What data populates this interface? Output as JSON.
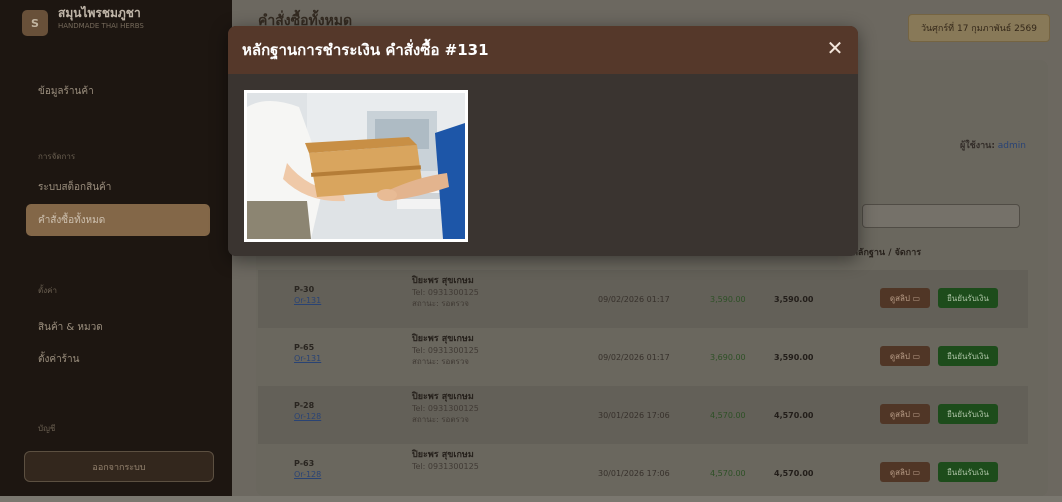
{
  "sidebar": {
    "brand_title": "สมุนไพรชมภูชา",
    "brand_subtitle": "HANDMADE THAI HERBS",
    "logo_text": "S",
    "items": {
      "dashboard": "ข้อมูลร้านค้า",
      "section_heading": "การจัดการ",
      "inventory": "ระบบสต็อกสินค้า",
      "orders": "คำสั่งซื้อทั้งหมด",
      "section_heading2": "ตั้งค่า",
      "products": "สินค้า & หมวด",
      "shop": "ตั้งค่าร้าน",
      "section_heading3": "บัญชี"
    },
    "logout_label": "ออกจากระบบ"
  },
  "header": {
    "page_title": "คำสั่งซื้อทั้งหมด",
    "date_badge": "วันศุกร์ที่ 17 กุมภาพันธ์ 2569"
  },
  "filters": {
    "prefix": "ผู้ใช้งาน:",
    "link": "admin"
  },
  "table": {
    "evidence_header": "หลักฐาน / จัดการ",
    "rows": [
      {
        "pid": "P-30",
        "order": "Or-131",
        "name": "ปิยะพร สุขเกษม",
        "tel": "Tel: 0931300125",
        "status": "สถานะ: รอตรวจ",
        "date": "09/02/2026 01:17",
        "amount": "3,590.00",
        "total": "3,590.00",
        "slip": "ดูสลิป",
        "confirm": "ยืนยันรับเงิน"
      },
      {
        "pid": "P-65",
        "order": "Or-131",
        "name": "ปิยะพร สุขเกษม",
        "tel": "Tel: 0931300125",
        "status": "สถานะ: รอตรวจ",
        "date": "09/02/2026 01:17",
        "amount": "3,690.00",
        "total": "3,590.00",
        "slip": "ดูสลิป",
        "confirm": "ยืนยันรับเงิน"
      },
      {
        "pid": "P-28",
        "order": "Or-128",
        "name": "ปิยะพร สุขเกษม",
        "tel": "Tel: 0931300125",
        "status": "สถานะ: รอตรวจ",
        "date": "30/01/2026 17:06",
        "amount": "4,570.00",
        "total": "4,570.00",
        "slip": "ดูสลิป",
        "confirm": "ยืนยันรับเงิน"
      },
      {
        "pid": "P-63",
        "order": "Or-128",
        "name": "ปิยะพร สุขเกษม",
        "tel": "Tel: 0931300125",
        "status": "",
        "date": "30/01/2026 17:06",
        "amount": "4,570.00",
        "total": "4,570.00",
        "slip": "ดูสลิป",
        "confirm": "ยืนยันรับเงิน"
      }
    ]
  },
  "modal": {
    "title": "หลักฐานการชำระเงิน คำสั่งซื้อ #131",
    "close_glyph": "✕"
  },
  "icons": {
    "close": "close-icon",
    "slip_image": "payment-slip-image",
    "camera": "image-icon"
  },
  "colors": {
    "sidebar_bg": "#1f1813",
    "accent_active": "#9c7a56",
    "modal_header": "#55382a",
    "confirm_green": "#1f5a1f"
  }
}
